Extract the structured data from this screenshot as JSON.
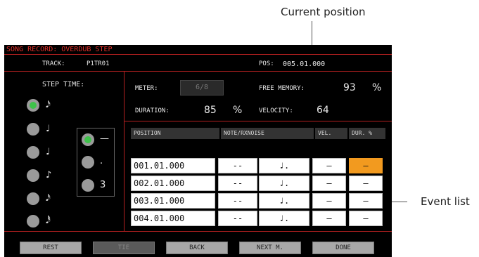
{
  "callouts": {
    "current_position": "Current position",
    "event_list": "Event list"
  },
  "header": {
    "title": "SONG RECORD: OVERDUB STEP"
  },
  "info": {
    "track_label": "TRACK:",
    "track_value": "P1TR01",
    "pos_label": "POS:",
    "pos_value": "005.01.000"
  },
  "step_time": {
    "label": "STEP TIME:",
    "selected_note_index": 0,
    "selected_mod_index": 0,
    "mods": [
      "—",
      ".",
      "3"
    ]
  },
  "params": {
    "meter_label": "METER:",
    "meter_value": "6/8",
    "free_memory_label": "FREE MEMORY:",
    "free_memory_value": "93",
    "free_memory_unit": "%",
    "duration_label": "DURATION:",
    "duration_value": "85",
    "duration_unit": "%",
    "velocity_label": "VELOCITY:",
    "velocity_value": "64"
  },
  "event_table": {
    "headers": [
      "POSITION",
      "NOTE/RXNOISE",
      "VEL.",
      "DUR. %"
    ],
    "rows": [
      {
        "position": "001.01.000",
        "note": "--",
        "vel": "–",
        "dur": "–"
      },
      {
        "position": "002.01.000",
        "note": "--",
        "vel": "–",
        "dur": "–"
      },
      {
        "position": "003.01.000",
        "note": "--",
        "vel": "–",
        "dur": "–"
      },
      {
        "position": "004.01.000",
        "note": "--",
        "vel": "–",
        "dur": "–"
      }
    ],
    "note_glyph": "♩."
  },
  "buttons": {
    "rest": "REST",
    "tie": "TIE",
    "back": "BACK",
    "next": "NEXT M.",
    "done": "DONE"
  },
  "colors": {
    "header_red": "#e0302a",
    "selected_green": "#3ec24a",
    "highlight_orange": "#f29a1f"
  }
}
